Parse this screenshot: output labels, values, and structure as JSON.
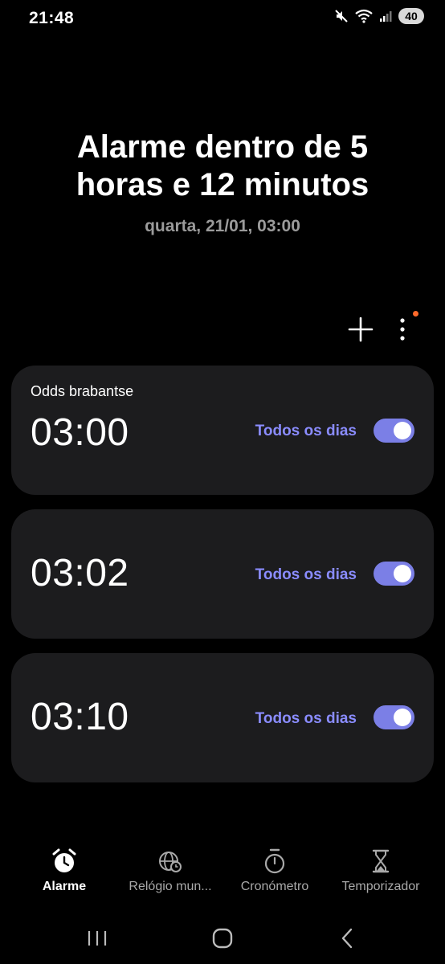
{
  "status_bar": {
    "time": "21:48",
    "icons": [
      "mute-icon",
      "wifi-icon",
      "signal-icon"
    ],
    "battery": "40"
  },
  "header": {
    "headline": "Alarme dentro de 5\nhoras e 12 minutos",
    "subline": "quarta, 21/01, 03:00"
  },
  "toolbar": {
    "add_icon": "plus-icon",
    "more_icon": "more-vertical-icon",
    "notification_dot_color": "#ff6a2b"
  },
  "alarms": [
    {
      "label": "Odds brabantse",
      "time": "03:00",
      "repeat": "Todos os dias",
      "enabled": true
    },
    {
      "label": "",
      "time": "03:02",
      "repeat": "Todos os dias",
      "enabled": true
    },
    {
      "label": "",
      "time": "03:10",
      "repeat": "Todos os dias",
      "enabled": true
    }
  ],
  "bottom_nav": [
    {
      "label": "Alarme",
      "icon": "alarm-clock-icon",
      "active": true
    },
    {
      "label": "Relógio mun...",
      "icon": "world-clock-icon",
      "active": false
    },
    {
      "label": "Cronómetro",
      "icon": "stopwatch-icon",
      "active": false
    },
    {
      "label": "Temporizador",
      "icon": "hourglass-icon",
      "active": false
    }
  ],
  "system_nav": [
    "recents-icon",
    "home-icon",
    "back-icon"
  ],
  "colors": {
    "background": "#000000",
    "card": "#1c1c1e",
    "accent": "#8a8cff",
    "toggle_on": "#7b7fe6"
  }
}
